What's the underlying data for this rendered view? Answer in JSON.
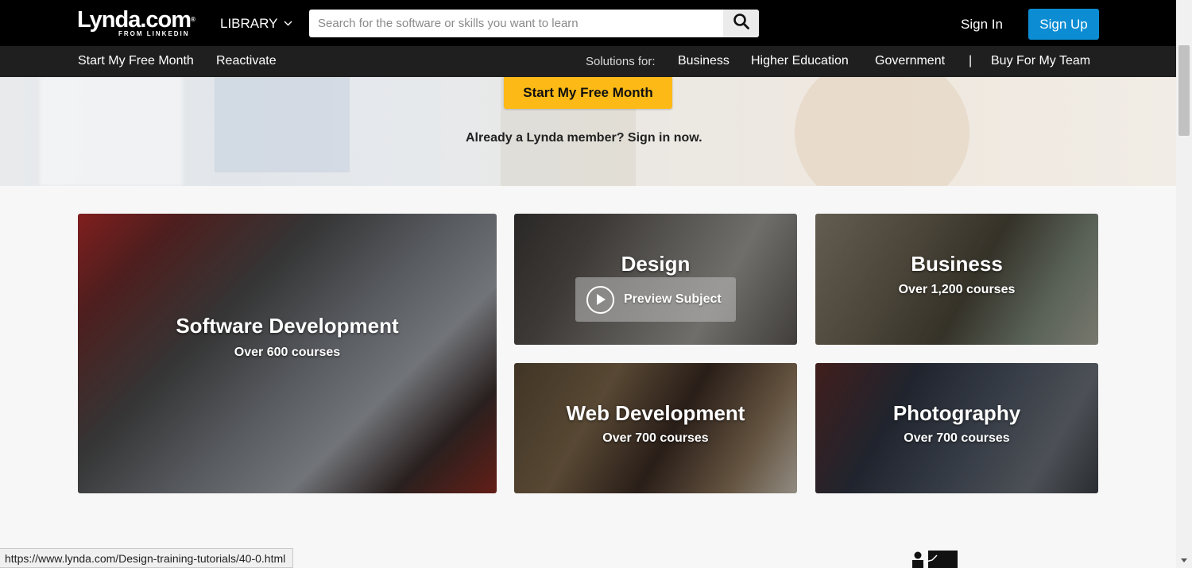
{
  "header": {
    "logo_text": "Lynda.com",
    "logo_sub": "FROM LINKEDIN",
    "logo_reg": "®",
    "library_label": "LIBRARY",
    "search_placeholder": "Search for the software or skills you want to learn",
    "sign_in_label": "Sign In",
    "sign_up_label": "Sign Up"
  },
  "subnav": {
    "start_free_month": "Start My Free Month",
    "reactivate": "Reactivate",
    "solutions_for": "Solutions for:",
    "business": "Business",
    "higher_education": "Higher Education",
    "government": "Government",
    "separator": "|",
    "buy_for_team": "Buy For My Team"
  },
  "hero": {
    "cta_label": "Start My Free Month",
    "member_text": "Already a Lynda member? Sign in now."
  },
  "tiles": {
    "software": {
      "title": "Software Development",
      "count": "Over 600 courses"
    },
    "design": {
      "title": "Design",
      "preview_label": "Preview Subject"
    },
    "business": {
      "title": "Business",
      "count": "Over 1,200 courses"
    },
    "web": {
      "title": "Web Development",
      "count": "Over 700 courses"
    },
    "photo": {
      "title": "Photography",
      "count": "Over 700 courses"
    }
  },
  "status_bar": {
    "url": "https://www.lynda.com/Design-training-tutorials/40-0.html"
  },
  "icons": {
    "search": "search-icon",
    "chevron": "chevron-down-icon",
    "play": "play-icon",
    "instructor": "instructor-icon"
  },
  "colors": {
    "accent_yellow": "#fdb915",
    "signup_blue": "#0c8dd3",
    "topbar_black": "#000000",
    "subbar_dark": "#1f1f1f"
  }
}
